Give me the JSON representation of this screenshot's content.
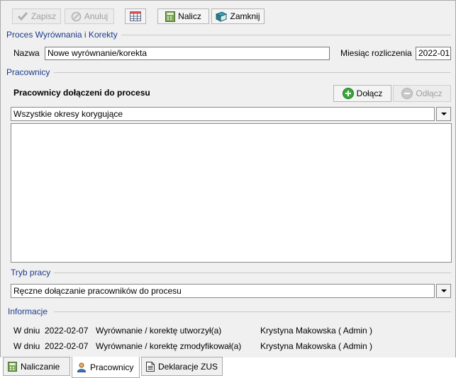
{
  "toolbar": {
    "save_label": "Zapisz",
    "cancel_label": "Anuluj",
    "calculate_label": "Nalicz",
    "close_label": "Zamknij"
  },
  "process_section": {
    "title": "Proces Wyrównania i Korekty",
    "name_label": "Nazwa",
    "name_value": "Nowe wyrównanie/korekta",
    "month_label": "Miesiąc rozliczenia",
    "month_value": "2022-01"
  },
  "employees_section": {
    "title": "Pracownicy",
    "subtitle": "Pracownicy dołączeni do procesu",
    "attach_label": "Dołącz",
    "detach_label": "Odłącz",
    "filter_value": "Wszystkie okresy korygujące"
  },
  "work_mode_section": {
    "title": "Tryb pracy",
    "mode_value": "Ręczne dołączanie pracowników do procesu"
  },
  "info_section": {
    "title": "Informacje",
    "rows": [
      {
        "prefix": "W dniu",
        "date": "2022-02-07",
        "action": "Wyrównanie / korektę utworzył(a)",
        "user": "Krystyna Makowska ( Admin )"
      },
      {
        "prefix": "W dniu",
        "date": "2022-02-07",
        "action": "Wyrównanie / korektę zmodyfikował(a)",
        "user": "Krystyna Makowska ( Admin )"
      }
    ]
  },
  "tabs": [
    {
      "label": "Naliczanie",
      "icon": "calculator-icon"
    },
    {
      "label": "Pracownicy",
      "icon": "person-icon"
    },
    {
      "label": "Deklaracje ZUS",
      "icon": "document-icon"
    }
  ],
  "active_tab": "Pracownicy",
  "colors": {
    "section_title": "#1c3b8c",
    "attach_icon": "#3aa53a",
    "window_bg": "#f0f0f0"
  }
}
